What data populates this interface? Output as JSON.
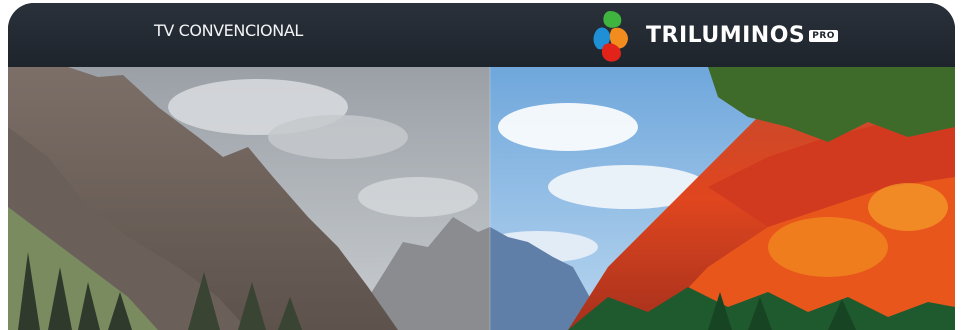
{
  "header": {
    "left_label": "TV CONVENCIONAL",
    "brand_name": "TRILUMINOS",
    "brand_badge": "PRO",
    "brand_logo_icon": "triluminos-petal-logo-icon"
  },
  "colors": {
    "header_background": "#1e242c",
    "brand_green": "#3fb43f",
    "brand_blue": "#1f8fd6",
    "brand_orange": "#f28c1e",
    "brand_red": "#e2231a"
  }
}
